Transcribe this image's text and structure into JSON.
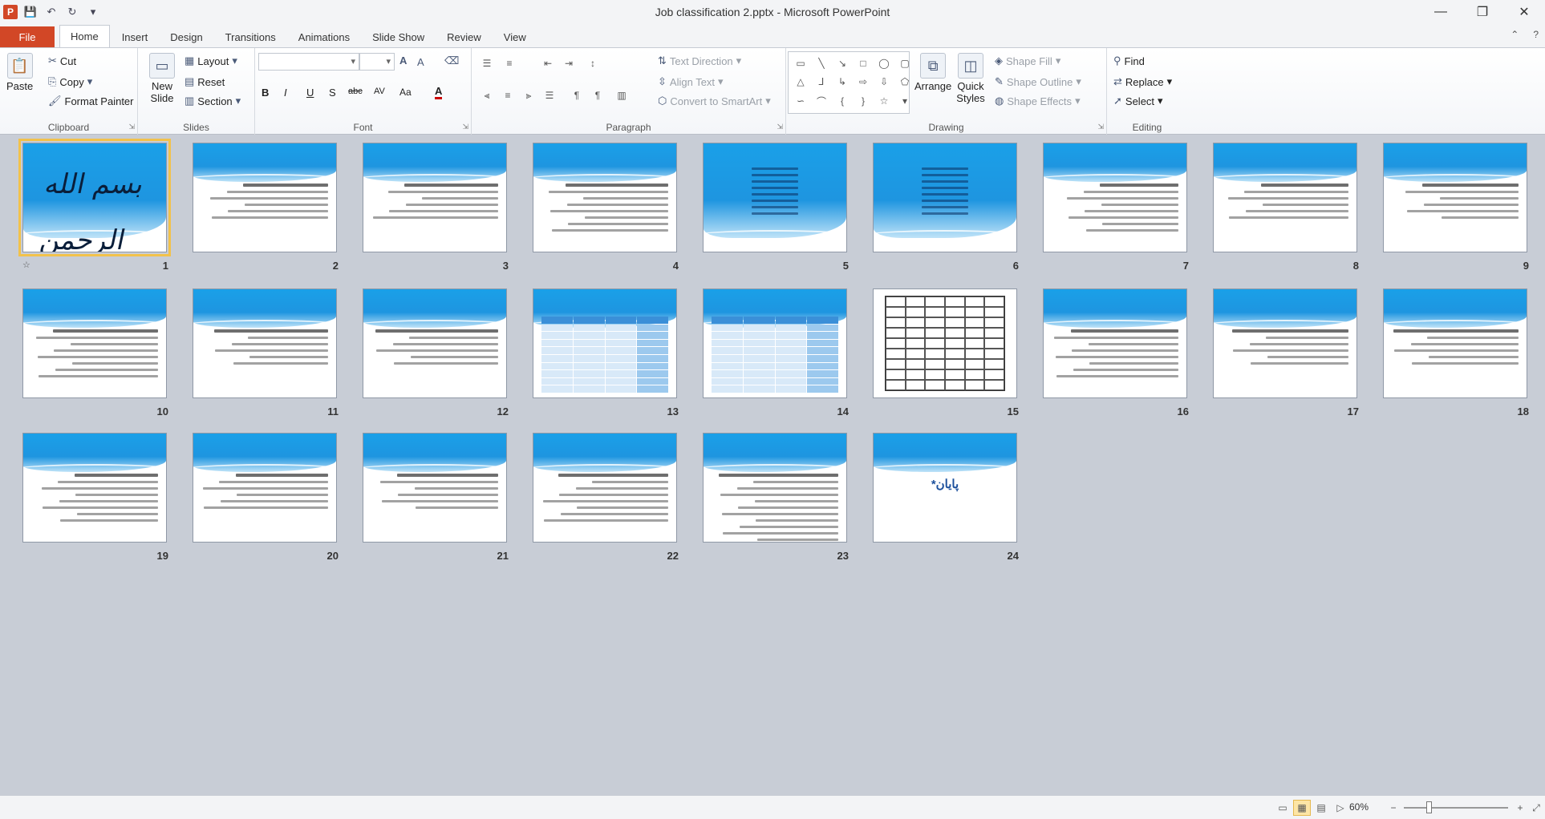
{
  "window": {
    "title": "Job classification 2.pptx - Microsoft PowerPoint",
    "app_icon": "P",
    "controls": {
      "minimize": "—",
      "restore": "❐",
      "close": "✕"
    }
  },
  "qat": {
    "save": "💾",
    "undo": "↶",
    "redo": "↻",
    "customize": "▾"
  },
  "tabs": [
    "File",
    "Home",
    "Insert",
    "Design",
    "Transitions",
    "Animations",
    "Slide Show",
    "Review",
    "View"
  ],
  "active_tab": "Home",
  "ribbon": {
    "clipboard": {
      "label": "Clipboard",
      "paste": "Paste",
      "cut": "Cut",
      "copy": "Copy",
      "format_painter": "Format Painter"
    },
    "slides": {
      "label": "Slides",
      "new_slide": "New Slide",
      "layout": "Layout",
      "reset": "Reset",
      "section": "Section"
    },
    "font": {
      "label": "Font",
      "bold": "B",
      "italic": "I",
      "underline": "U",
      "shadow": "S",
      "strike": "abc",
      "spacing": "AV",
      "case": "Aa",
      "color": "A",
      "grow": "A",
      "shrink": "A"
    },
    "paragraph": {
      "label": "Paragraph",
      "text_direction": "Text Direction",
      "align_text": "Align Text",
      "convert_smartart": "Convert to SmartArt"
    },
    "drawing": {
      "label": "Drawing",
      "arrange": "Arrange",
      "quick_styles": "Quick Styles",
      "shape_fill": "Shape Fill",
      "shape_outline": "Shape Outline",
      "shape_effects": "Shape Effects"
    },
    "editing": {
      "label": "Editing",
      "find": "Find",
      "replace": "Replace",
      "select": "Select"
    }
  },
  "slides": [
    {
      "num": "1",
      "kind": "calligraphy",
      "text": "بسم الله الرحمن الرحیم"
    },
    {
      "num": "2",
      "kind": "text"
    },
    {
      "num": "3",
      "kind": "text"
    },
    {
      "num": "4",
      "kind": "text"
    },
    {
      "num": "5",
      "kind": "fullwave"
    },
    {
      "num": "6",
      "kind": "fullwave"
    },
    {
      "num": "7",
      "kind": "text"
    },
    {
      "num": "8",
      "kind": "text"
    },
    {
      "num": "9",
      "kind": "text"
    },
    {
      "num": "10",
      "kind": "text"
    },
    {
      "num": "11",
      "kind": "text"
    },
    {
      "num": "12",
      "kind": "text"
    },
    {
      "num": "13",
      "kind": "table"
    },
    {
      "num": "14",
      "kind": "table"
    },
    {
      "num": "15",
      "kind": "grid"
    },
    {
      "num": "16",
      "kind": "text"
    },
    {
      "num": "17",
      "kind": "text"
    },
    {
      "num": "18",
      "kind": "text"
    },
    {
      "num": "19",
      "kind": "text"
    },
    {
      "num": "20",
      "kind": "text"
    },
    {
      "num": "21",
      "kind": "text"
    },
    {
      "num": "22",
      "kind": "text"
    },
    {
      "num": "23",
      "kind": "densetext"
    },
    {
      "num": "24",
      "kind": "end",
      "text": "*پایان"
    }
  ],
  "status": {
    "zoom": "60%",
    "minus": "−",
    "plus": "+"
  }
}
